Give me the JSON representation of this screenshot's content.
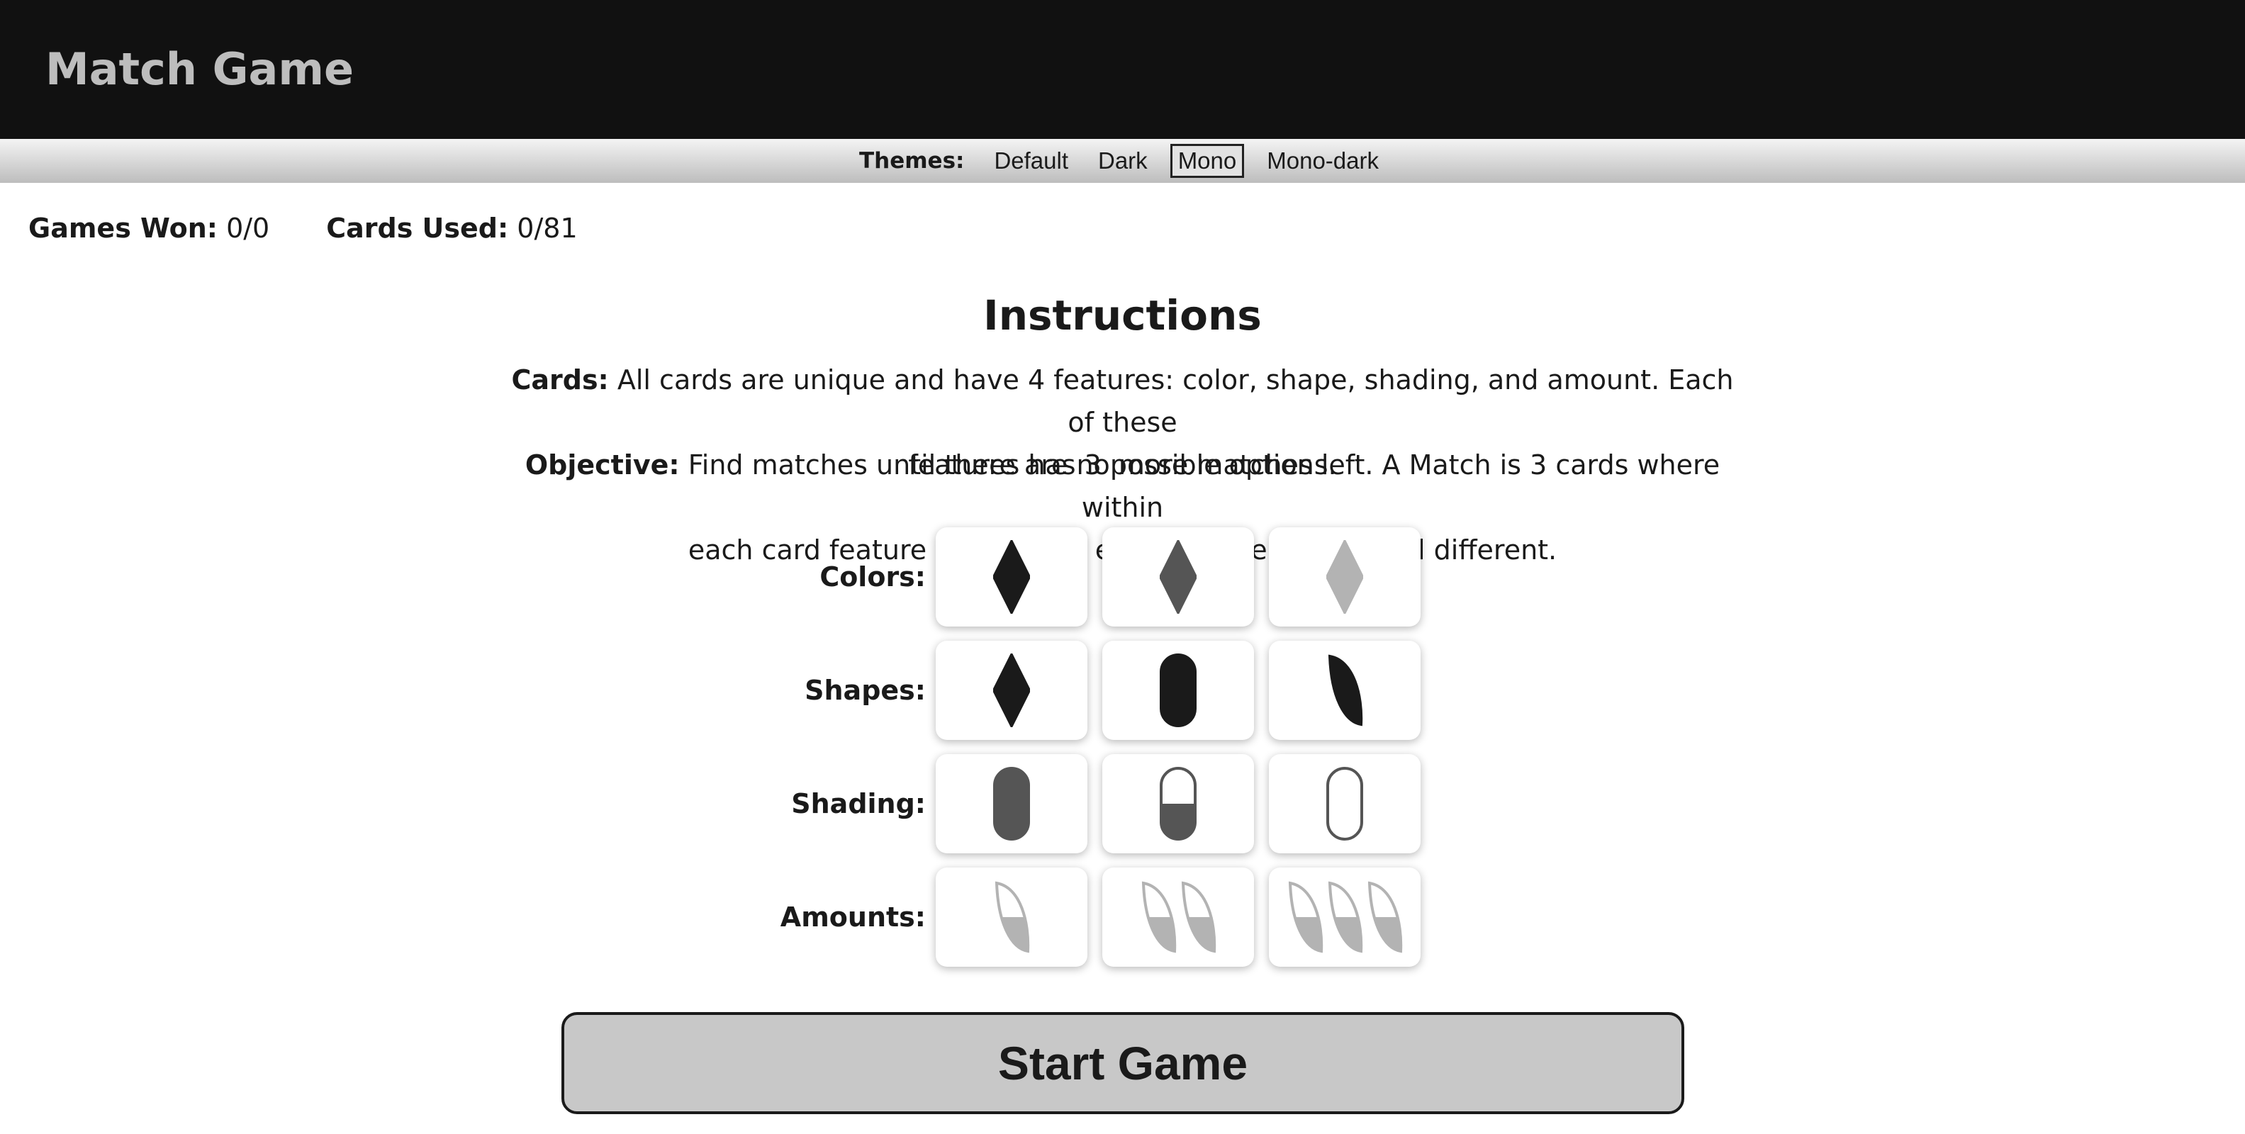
{
  "header": {
    "title": "Match Game"
  },
  "themes": {
    "label": "Themes:",
    "options": [
      "Default",
      "Dark",
      "Mono",
      "Mono-dark"
    ],
    "selected": "Mono"
  },
  "stats": {
    "games_won_label": "Games Won:",
    "games_won_value": "0/0",
    "cards_used_label": "Cards Used:",
    "cards_used_value": "0/81"
  },
  "instructions": {
    "title": "Instructions",
    "cards_label": "Cards:",
    "cards_text_line1": "All cards are unique and have 4 features: color, shape, shading, and amount. Each of these",
    "cards_text_line2": "features has 3 possible options.",
    "objective_label": "Objective:",
    "objective_text_line1": "Find matches until there are no more matches left. A Match is 3 cards where within",
    "objective_text_line2": "each card feature options are either all the same or all different."
  },
  "features": [
    {
      "label": "Colors:",
      "cards": [
        {
          "shape": "diamond",
          "color": "#1a1a1a",
          "shading": "solid",
          "amount": 1
        },
        {
          "shape": "diamond",
          "color": "#555555",
          "shading": "solid",
          "amount": 1
        },
        {
          "shape": "diamond",
          "color": "#b3b3b3",
          "shading": "solid",
          "amount": 1
        }
      ]
    },
    {
      "label": "Shapes:",
      "cards": [
        {
          "shape": "diamond",
          "color": "#1a1a1a",
          "shading": "solid",
          "amount": 1
        },
        {
          "shape": "oval",
          "color": "#1a1a1a",
          "shading": "solid",
          "amount": 1
        },
        {
          "shape": "squiggle",
          "color": "#1a1a1a",
          "shading": "solid",
          "amount": 1
        }
      ]
    },
    {
      "label": "Shading:",
      "cards": [
        {
          "shape": "oval",
          "color": "#555555",
          "shading": "solid",
          "amount": 1
        },
        {
          "shape": "oval",
          "color": "#555555",
          "shading": "half",
          "amount": 1
        },
        {
          "shape": "oval",
          "color": "#555555",
          "shading": "empty",
          "amount": 1
        }
      ]
    },
    {
      "label": "Amounts:",
      "cards": [
        {
          "shape": "squiggle",
          "color": "#b3b3b3",
          "shading": "half",
          "amount": 1
        },
        {
          "shape": "squiggle",
          "color": "#b3b3b3",
          "shading": "half",
          "amount": 2
        },
        {
          "shape": "squiggle",
          "color": "#b3b3b3",
          "shading": "half",
          "amount": 3
        }
      ]
    }
  ],
  "start_button": {
    "label": "Start Game"
  }
}
